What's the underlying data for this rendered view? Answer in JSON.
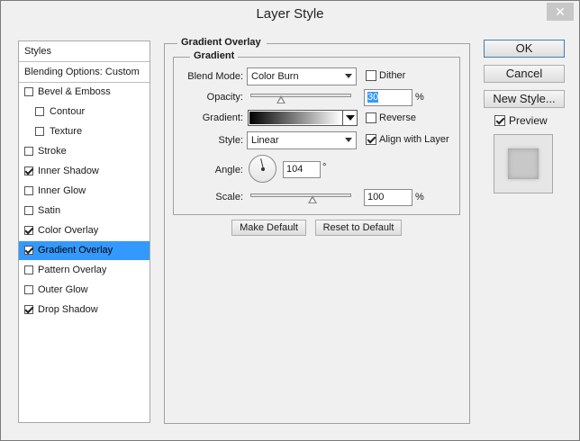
{
  "title": "Layer Style",
  "close_glyph": "✕",
  "styles_list": {
    "header": "Styles",
    "blending": "Blending Options: Custom",
    "items": [
      {
        "label": "Bevel & Emboss",
        "checked": false
      },
      {
        "label": "Contour",
        "checked": false
      },
      {
        "label": "Texture",
        "checked": false
      },
      {
        "label": "Stroke",
        "checked": false
      },
      {
        "label": "Inner Shadow",
        "checked": true
      },
      {
        "label": "Inner Glow",
        "checked": false
      },
      {
        "label": "Satin",
        "checked": false
      },
      {
        "label": "Color Overlay",
        "checked": true
      },
      {
        "label": "Gradient Overlay",
        "checked": true,
        "selected": true
      },
      {
        "label": "Pattern Overlay",
        "checked": false
      },
      {
        "label": "Outer Glow",
        "checked": false
      },
      {
        "label": "Drop Shadow",
        "checked": true
      }
    ]
  },
  "panel": {
    "group_title": "Gradient Overlay",
    "section_title": "Gradient",
    "blend_mode": {
      "label": "Blend Mode:",
      "value": "Color Burn"
    },
    "dither": {
      "label": "Dither",
      "checked": false
    },
    "opacity": {
      "label": "Opacity:",
      "value": "30",
      "unit": "%",
      "level": 30
    },
    "gradient": {
      "label": "Gradient:",
      "start_color": "#000000",
      "end_color": "#ffffff"
    },
    "reverse": {
      "label": "Reverse",
      "checked": false
    },
    "style": {
      "label": "Style:",
      "value": "Linear"
    },
    "align_with_layer": {
      "label": "Align with Layer",
      "checked": true
    },
    "angle": {
      "label": "Angle:",
      "value": "104",
      "unit": "°"
    },
    "scale": {
      "label": "Scale:",
      "value": "100",
      "unit": "%",
      "level": 100
    },
    "make_default": "Make Default",
    "reset_to_default": "Reset to Default"
  },
  "buttons": {
    "ok": "OK",
    "cancel": "Cancel",
    "new_style": "New Style..."
  },
  "preview": {
    "label": "Preview",
    "checked": true
  },
  "colors": {
    "selection": "#3399ff",
    "background": "#f0f0f0"
  }
}
